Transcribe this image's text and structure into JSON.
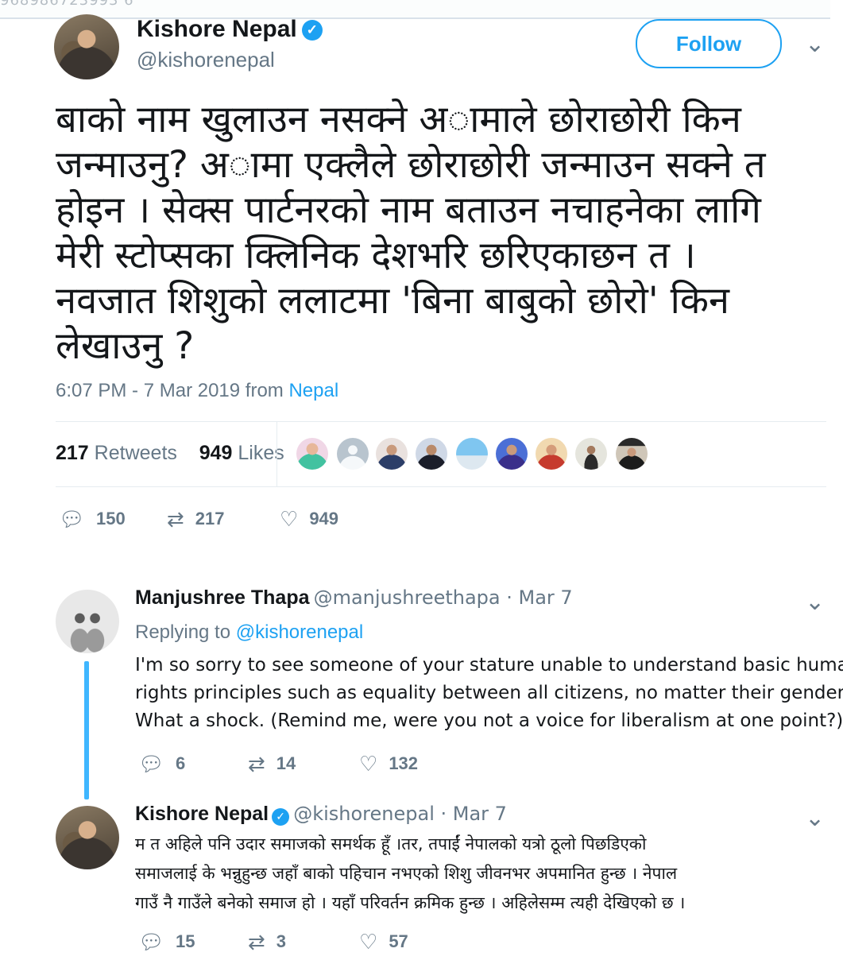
{
  "top_strip_text": "968986723993 6",
  "main_tweet": {
    "author_name": "Kishore Nepal",
    "handle": "@kishorenepal",
    "follow_label": "Follow",
    "text_lines": [
      "बाको नाम खुलाउन नसक्ने अ◌ामाले छोराछोरी किन",
      "जन्माउनु? अ◌ामा एक्लैले छोराछोरी जन्माउन सक्ने त",
      "होइन । सेक्स पार्टनरको नाम बताउन नचाहनेका  लागि",
      "मेरी स्टोप्सका क्लिनिक देशभरि छरिएकाछन त ।",
      "नवजात शिशुको ललाटमा 'बिना बाबुको छोरो' किन",
      "लेखाउनु ?"
    ],
    "time": "6:07 PM - 7 Mar 2019 from",
    "location": "Nepal",
    "retweets_count": "217",
    "retweets_label": "Retweets",
    "likes_count": "949",
    "likes_label": "Likes",
    "actions": {
      "replies": "150",
      "retweets": "217",
      "likes": "949"
    }
  },
  "replies": [
    {
      "author_name": "Manjushree Thapa",
      "meta": "@manjushreethapa · Mar 7",
      "replying_prefix": "Replying to",
      "replying_to": "@kishorenepal",
      "text_lines": [
        "I'm so sorry to see someone of your stature unable to understand basic human",
        "rights principles such as equality between all citizens, no matter their gender.",
        "What a shock. (Remind me, were you not a voice for liberalism at one point?)"
      ],
      "actions": {
        "replies": "6",
        "retweets": "14",
        "likes": "132"
      }
    },
    {
      "author_name": "Kishore Nepal",
      "meta": "@kishorenepal · Mar 7",
      "text_lines": [
        "म त अहिले पनि उदार समाजको समर्थक हूँ ।तर, तपाईं नेपालको यत्रो ठूलो पिछडिएको",
        "समाजलाई के भन्नुहुन्छ जहाँ बाको पहिचान नभएको शिशु जीवनभर अपमानित हुन्छ । नेपाल",
        "गाउँ नै गाउँले बनेको समाज हो । यहाँ परिवर्तन क्रमिक हुन्छ । अहिलेसम्म त्यही देखिएको छ ।"
      ],
      "actions": {
        "replies": "15",
        "retweets": "3",
        "likes": "57"
      }
    }
  ],
  "icons": {
    "reply": "speech-bubble-icon",
    "retweet": "retweet-icon",
    "like": "heart-icon",
    "verified": "verified-badge-icon",
    "menu": "chevron-down-icon"
  },
  "colors": {
    "accent": "#1da1f2",
    "muted": "#657786",
    "text": "#14171a"
  }
}
